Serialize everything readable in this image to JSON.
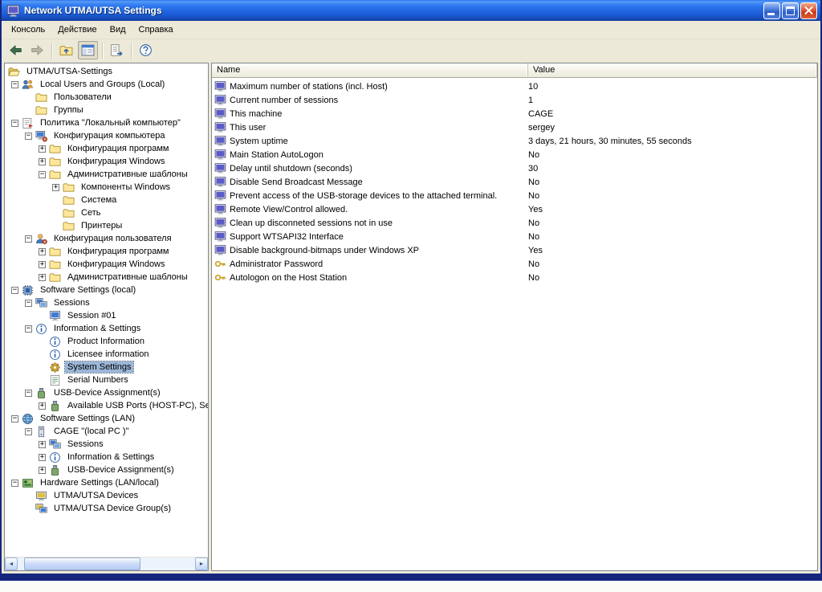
{
  "window": {
    "title": "Network UTMA/UTSA Settings",
    "icon": "terminal",
    "controls": [
      {
        "name": "minimize"
      },
      {
        "name": "maximize"
      },
      {
        "name": "close"
      }
    ]
  },
  "menu": {
    "items": [
      {
        "label": "Консоль"
      },
      {
        "label": "Действие"
      },
      {
        "label": "Вид"
      },
      {
        "label": "Справка"
      }
    ]
  },
  "toolbar": {
    "groups": [
      [
        {
          "name": "back",
          "state": "normal"
        },
        {
          "name": "forward",
          "state": "disabled"
        }
      ],
      [
        {
          "name": "up-folder",
          "state": "normal"
        },
        {
          "name": "toggle-console-tree",
          "state": "toggled"
        }
      ],
      [
        {
          "name": "export-list",
          "state": "normal"
        }
      ],
      [
        {
          "name": "help",
          "state": "normal"
        }
      ]
    ]
  },
  "tree": {
    "items": [
      {
        "label": "UTMA/UTSA-Settings",
        "level": 0,
        "expander": "none",
        "icon": "folder-open"
      },
      {
        "label": "Local Users and Groups (Local)",
        "level": 1,
        "expander": "minus",
        "icon": "users"
      },
      {
        "label": "Пользователи",
        "level": 2,
        "expander": "none",
        "icon": "folder"
      },
      {
        "label": "Группы",
        "level": 2,
        "expander": "none",
        "icon": "folder"
      },
      {
        "label": "Политика \"Локальный компьютер\"",
        "level": 1,
        "expander": "minus",
        "icon": "policy"
      },
      {
        "label": "Конфигурация компьютера",
        "level": 2,
        "expander": "minus",
        "icon": "computer-config"
      },
      {
        "label": "Конфигурация программ",
        "level": 3,
        "expander": "plus",
        "icon": "folder"
      },
      {
        "label": "Конфигурация Windows",
        "level": 3,
        "expander": "plus",
        "icon": "folder"
      },
      {
        "label": "Административные шаблоны",
        "level": 3,
        "expander": "minus",
        "icon": "folder"
      },
      {
        "label": "Компоненты Windows",
        "level": 4,
        "expander": "plus",
        "icon": "folder"
      },
      {
        "label": "Система",
        "level": 4,
        "expander": "none",
        "icon": "folder"
      },
      {
        "label": "Сеть",
        "level": 4,
        "expander": "none",
        "icon": "folder"
      },
      {
        "label": "Принтеры",
        "level": 4,
        "expander": "none",
        "icon": "folder"
      },
      {
        "label": "Конфигурация пользователя",
        "level": 2,
        "expander": "minus",
        "icon": "user-config"
      },
      {
        "label": "Конфигурация программ",
        "level": 3,
        "expander": "plus",
        "icon": "folder"
      },
      {
        "label": "Конфигурация Windows",
        "level": 3,
        "expander": "plus",
        "icon": "folder"
      },
      {
        "label": "Административные шаблоны",
        "level": 3,
        "expander": "plus",
        "icon": "folder"
      },
      {
        "label": "Software Settings (local)",
        "level": 1,
        "expander": "minus",
        "icon": "chip"
      },
      {
        "label": "Sessions",
        "level": 2,
        "expander": "minus",
        "icon": "sessions"
      },
      {
        "label": "Session #01",
        "level": 3,
        "expander": "none",
        "icon": "monitor"
      },
      {
        "label": "Information & Settings",
        "level": 2,
        "expander": "minus",
        "icon": "info"
      },
      {
        "label": "Product Information",
        "level": 3,
        "expander": "none",
        "icon": "info"
      },
      {
        "label": "Licensee information",
        "level": 3,
        "expander": "none",
        "icon": "info"
      },
      {
        "label": "System Settings",
        "level": 3,
        "expander": "none",
        "icon": "gear",
        "selected": true
      },
      {
        "label": "Serial Numbers",
        "level": 3,
        "expander": "none",
        "icon": "serial"
      },
      {
        "label": "USB-Device Assignment(s)",
        "level": 2,
        "expander": "minus",
        "icon": "usb"
      },
      {
        "label": "Available USB Ports (HOST-PC), Sett",
        "level": 3,
        "expander": "plus",
        "icon": "usb"
      },
      {
        "label": "Software Settings (LAN)",
        "level": 1,
        "expander": "minus",
        "icon": "globe"
      },
      {
        "label": "CAGE \"(local PC )\"",
        "level": 2,
        "expander": "minus",
        "icon": "pc-tower"
      },
      {
        "label": "Sessions",
        "level": 3,
        "expander": "plus",
        "icon": "sessions"
      },
      {
        "label": "Information & Settings",
        "level": 3,
        "expander": "plus",
        "icon": "info"
      },
      {
        "label": "USB-Device Assignment(s)",
        "level": 3,
        "expander": "plus",
        "icon": "usb"
      },
      {
        "label": "Hardware Settings (LAN/local)",
        "level": 1,
        "expander": "minus",
        "icon": "hardware"
      },
      {
        "label": "UTMA/UTSA Devices",
        "level": 2,
        "expander": "none",
        "icon": "device"
      },
      {
        "label": "UTMA/UTSA Device Group(s)",
        "level": 2,
        "expander": "none",
        "icon": "device-group"
      }
    ]
  },
  "list": {
    "columns": [
      "Name",
      "Value"
    ],
    "rows": [
      {
        "icon": "terminal",
        "name": "Maximum number of stations (incl. Host)",
        "value": "10"
      },
      {
        "icon": "terminal",
        "name": "Current number of sessions",
        "value": "1"
      },
      {
        "icon": "terminal",
        "name": "This machine",
        "value": "CAGE"
      },
      {
        "icon": "terminal",
        "name": "This user",
        "value": "sergey"
      },
      {
        "icon": "terminal",
        "name": "System uptime",
        "value": "3 days, 21 hours, 30 minutes, 55 seconds"
      },
      {
        "icon": "terminal",
        "name": "Main Station AutoLogon",
        "value": "No"
      },
      {
        "icon": "terminal",
        "name": "Delay until shutdown (seconds)",
        "value": "30"
      },
      {
        "icon": "terminal",
        "name": "Disable Send Broadcast Message",
        "value": "No"
      },
      {
        "icon": "terminal",
        "name": "Prevent access of the USB-storage devices to the attached terminal.",
        "value": "No"
      },
      {
        "icon": "terminal",
        "name": "Remote View/Control allowed.",
        "value": "Yes"
      },
      {
        "icon": "terminal",
        "name": "Clean up disconneted sessions not in use",
        "value": "No"
      },
      {
        "icon": "terminal",
        "name": "Support WTSAPI32 Interface",
        "value": "No"
      },
      {
        "icon": "terminal",
        "name": "Disable background-bitmaps under Windows XP",
        "value": "Yes"
      },
      {
        "icon": "key",
        "name": "Administrator Password",
        "value": "No"
      },
      {
        "icon": "key",
        "name": "Autologon on the Host Station",
        "value": "No"
      }
    ]
  },
  "glyphs": {
    "expander_expanded": "−",
    "expander_collapsed": "+",
    "scroll_left": "◄",
    "scroll_right": "►"
  },
  "colors": {
    "titlebar_blue": "#2E77EE",
    "selection": "#9CB6D8",
    "window_border": "#16277E",
    "menubar_bg": "#ECE9D8"
  }
}
